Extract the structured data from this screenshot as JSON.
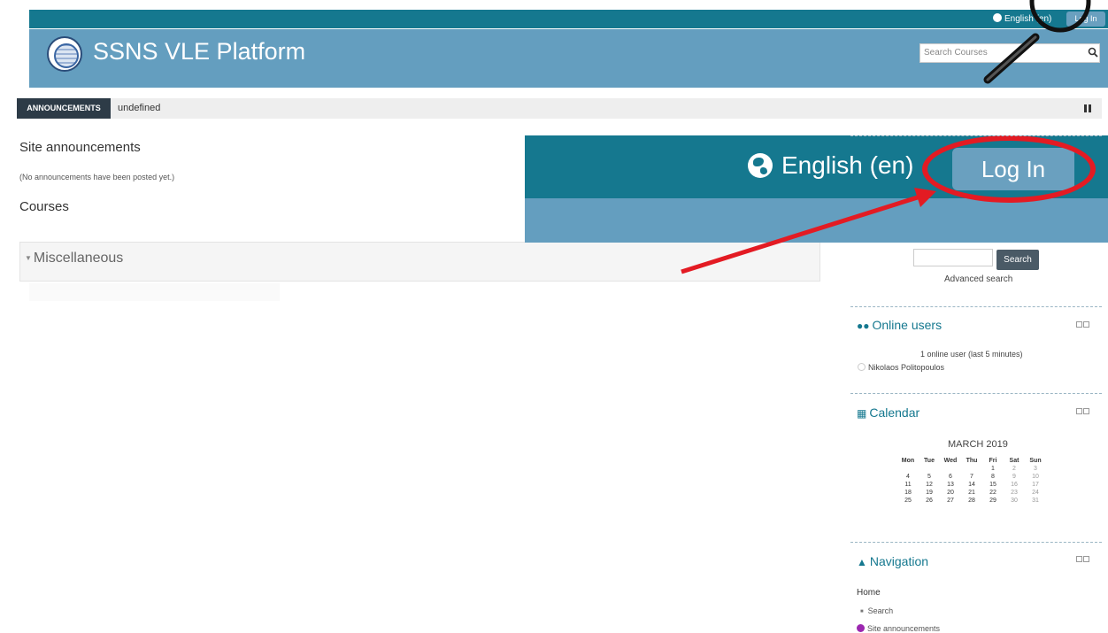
{
  "colors": {
    "topbar": "#15788f",
    "header": "#649ebf",
    "highlight": "#e31b23",
    "block_title": "#15788f"
  },
  "topbar": {
    "language": "English (en)",
    "login_label": "Log In"
  },
  "header": {
    "site_title": "SSNS VLE Platform",
    "search_placeholder": "Search Courses",
    "search_icon": "search-icon"
  },
  "announcements_bar": {
    "label": "ANNOUNCEMENTS",
    "text": "undefined"
  },
  "main": {
    "site_announcements_title": "Site announcements",
    "no_announcements": "(No announcements have been posted yet.)",
    "courses_title": "Courses",
    "category_name": "Miscellaneous"
  },
  "zoom": {
    "language": "English (en)",
    "login_label": "Log In"
  },
  "search_block": {
    "button_label": "Search",
    "advanced_link": "Advanced search"
  },
  "online_users": {
    "title": "Online users",
    "count_text": "1 online user (last 5 minutes)",
    "user_name": "Nikolaos Politopoulos"
  },
  "calendar": {
    "title": "Calendar",
    "month": "MARCH 2019",
    "weekdays": [
      "Mon",
      "Tue",
      "Wed",
      "Thu",
      "Fri",
      "Sat",
      "Sun"
    ],
    "weeks": [
      [
        "",
        "",
        "",
        "",
        "1",
        "2",
        "3"
      ],
      [
        "4",
        "5",
        "6",
        "7",
        "8",
        "9",
        "10"
      ],
      [
        "11",
        "12",
        "13",
        "14",
        "15",
        "16",
        "17"
      ],
      [
        "18",
        "19",
        "20",
        "21",
        "22",
        "23",
        "24"
      ],
      [
        "25",
        "26",
        "27",
        "28",
        "29",
        "30",
        "31"
      ]
    ]
  },
  "navigation": {
    "title": "Navigation",
    "home": "Home",
    "search": "Search",
    "site_announcements": "Site announcements"
  }
}
